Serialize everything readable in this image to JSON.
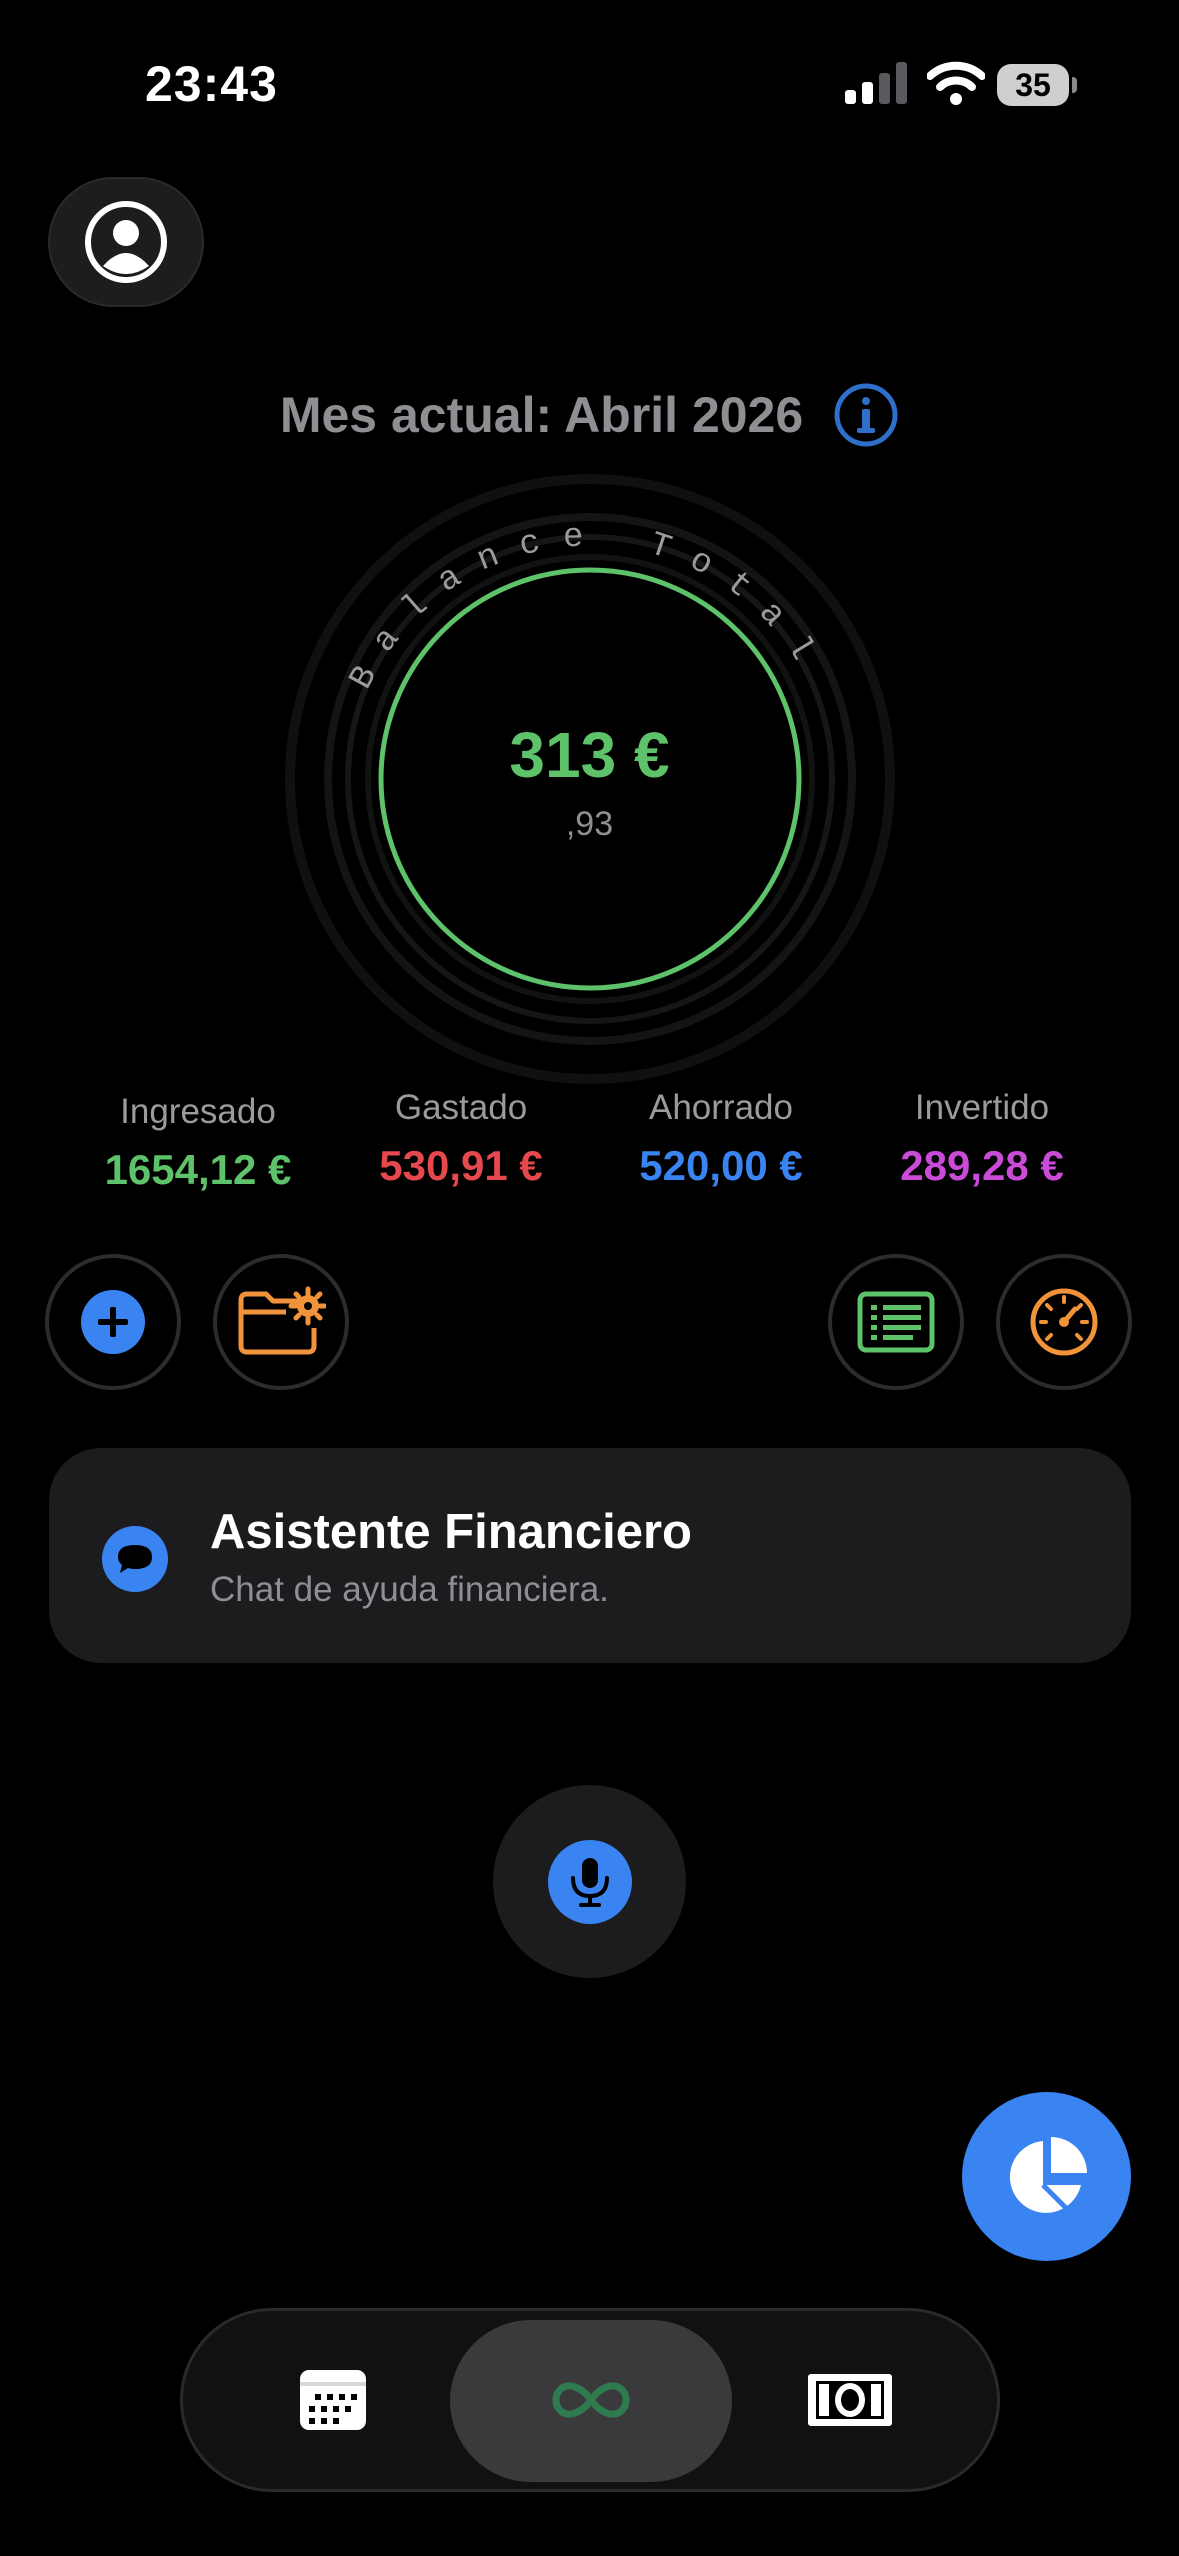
{
  "status_bar": {
    "time": "23:43",
    "battery": "35"
  },
  "header": {
    "month_label": "Mes actual: Abril 2026"
  },
  "balance": {
    "ring_label": "Balance Total",
    "amount": "313 €",
    "cents": ",93"
  },
  "stats": [
    {
      "label": "Ingresado",
      "value": "1654,12 €",
      "color": "#5ec26a"
    },
    {
      "label": "Gastado",
      "value": "530,91 €",
      "color": "#e5484d"
    },
    {
      "label": "Ahorrado",
      "value": "520,00 €",
      "color": "#3a84f2"
    },
    {
      "label": "Invertido",
      "value": "289,28 €",
      "color": "#c94bd8"
    }
  ],
  "assistant": {
    "title": "Asistente Financiero",
    "subtitle": "Chat de ayuda financiera."
  },
  "icons": {
    "profile": "person-circle-icon",
    "info": "info-icon",
    "add": "plus-icon",
    "folder_settings": "folder-gear-icon",
    "list": "list-icon",
    "gauge": "speedometer-icon",
    "chat": "chat-bubble-icon",
    "mic": "microphone-icon",
    "chart": "pie-chart-icon",
    "calendar": "calendar-icon",
    "infinity": "infinity-icon",
    "money": "banknote-icon"
  },
  "colors": {
    "accent_blue": "#3a84f2",
    "green": "#5ec26a",
    "orange": "#f0933a",
    "background": "#000000"
  }
}
